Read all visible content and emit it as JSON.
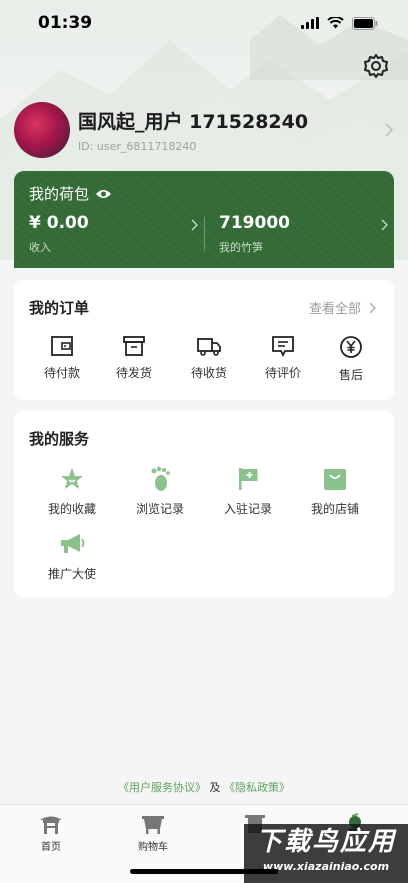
{
  "status": {
    "time": "01:39"
  },
  "profile": {
    "name": "国风起_用户 171528240",
    "id": "ID: user_6811718240"
  },
  "wallet": {
    "title": "我的荷包",
    "income_value": "¥ 0.00",
    "income_label": "收入",
    "bamboo_value": "719000",
    "bamboo_label": "我的竹笋"
  },
  "orders": {
    "title": "我的订单",
    "view_all": "查看全部",
    "items": [
      {
        "label": "待付款",
        "icon": "wallet-icon"
      },
      {
        "label": "待发货",
        "icon": "package-icon"
      },
      {
        "label": "待收货",
        "icon": "truck-icon"
      },
      {
        "label": "待评价",
        "icon": "review-icon"
      },
      {
        "label": "售后",
        "icon": "yen-icon"
      }
    ]
  },
  "services": {
    "title": "我的服务",
    "items": [
      {
        "label": "我的收藏",
        "icon": "star-icon"
      },
      {
        "label": "浏览记录",
        "icon": "footprint-icon"
      },
      {
        "label": "入驻记录",
        "icon": "flag-icon"
      },
      {
        "label": "我的店铺",
        "icon": "shop-icon"
      },
      {
        "label": "推广大使",
        "icon": "megaphone-icon"
      }
    ]
  },
  "agreement": {
    "user_link": "《用户服务协议》",
    "and": "及",
    "privacy_link": "《隐私政策》"
  },
  "tabbar": {
    "items": [
      {
        "label": "首页"
      },
      {
        "label": "购物车"
      }
    ]
  },
  "watermark": {
    "big": "下载鸟应用",
    "small": "www.xiazainiao.com"
  },
  "colors": {
    "brand_green": "#336a35",
    "icon_green": "#8cc08d",
    "link_green": "#5ea35f"
  }
}
